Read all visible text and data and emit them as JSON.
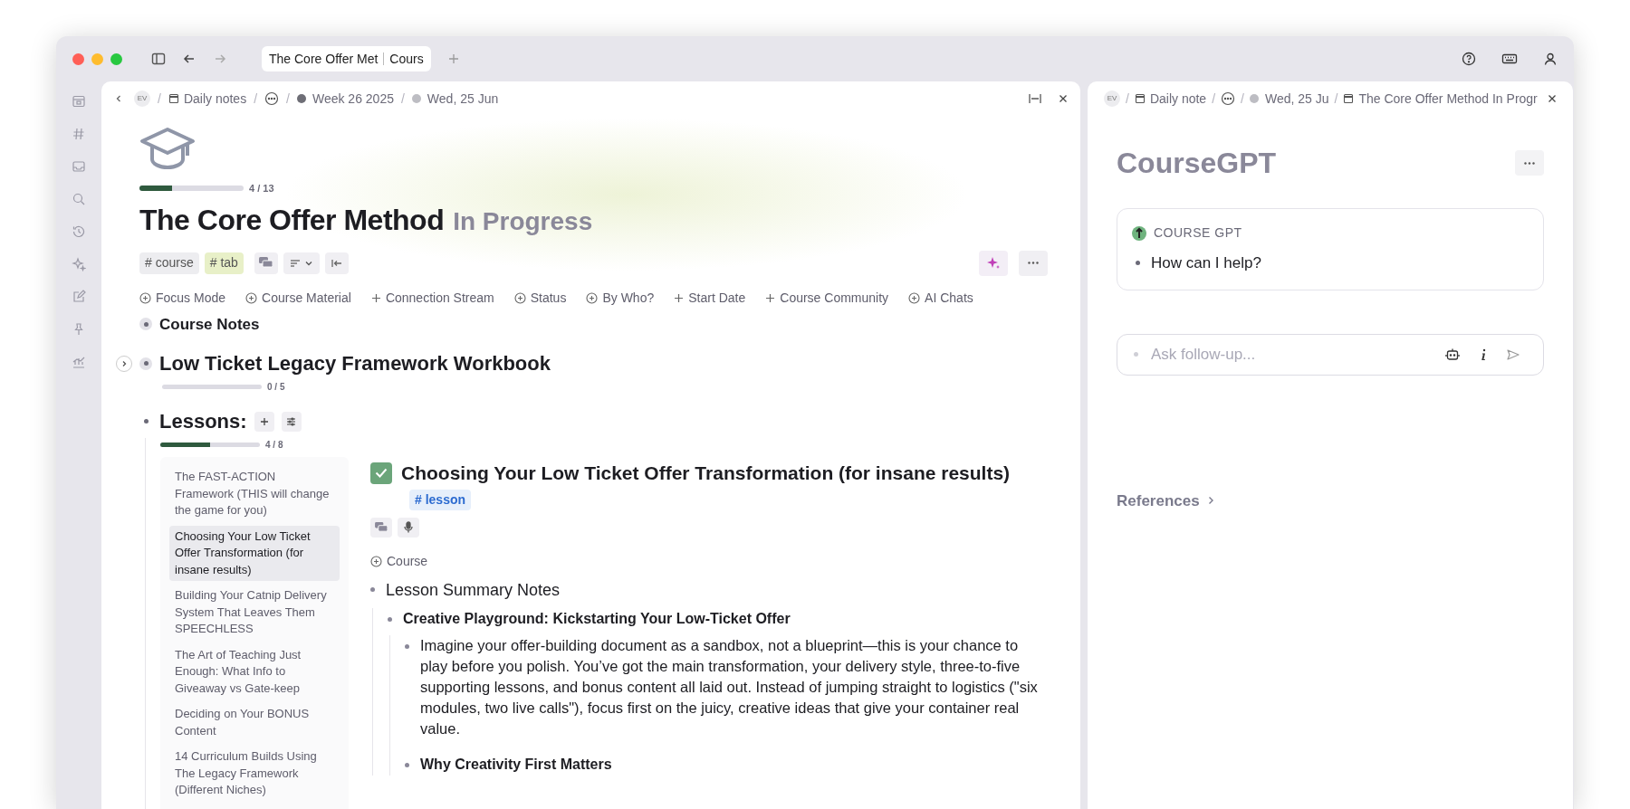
{
  "tab_bar": {
    "tab": {
      "parts": [
        "The Core Offer Met",
        "Cours"
      ],
      "selected": true
    }
  },
  "main": {
    "breadcrumb": [
      {
        "kind": "avatar",
        "text": "EV"
      },
      {
        "kind": "separator",
        "text": "/"
      },
      {
        "kind": "page",
        "text": "Daily notes"
      },
      {
        "kind": "separator",
        "text": "/"
      },
      {
        "kind": "more"
      },
      {
        "kind": "separator",
        "text": "/"
      },
      {
        "kind": "dot",
        "text": "Week 26 2025",
        "color": "#6e6e76"
      },
      {
        "kind": "separator",
        "text": "/"
      },
      {
        "kind": "dot",
        "text": "Wed, 25 Jun",
        "color": "#bdbdc3"
      }
    ],
    "progress": {
      "level": 0.31,
      "label": "4 / 13"
    },
    "title": "The Core Offer Method",
    "status": "In Progress",
    "tags": [
      {
        "text": "# course",
        "color": "#ededf0"
      },
      {
        "text": "# tab",
        "color": "#e8f0c8"
      }
    ],
    "properties": [
      {
        "kind": "circle",
        "label": "Focus Mode"
      },
      {
        "kind": "circle",
        "label": "Course Material"
      },
      {
        "kind": "plus",
        "label": "Connection Stream"
      },
      {
        "kind": "circle",
        "label": "Status"
      },
      {
        "kind": "circle",
        "label": "By Who?"
      },
      {
        "kind": "plus",
        "label": "Start Date"
      },
      {
        "kind": "plus",
        "label": "Course Community"
      },
      {
        "kind": "circle",
        "label": "AI Chats"
      }
    ],
    "course_notes": "Course Notes",
    "workbook": {
      "title": "Low Ticket Legacy Framework Workbook",
      "expanded": false,
      "progress": {
        "level": 0,
        "label": "0 / 5"
      }
    },
    "lessons": {
      "title": "Lessons:",
      "progress": {
        "level": 0.5,
        "label": "4 / 8"
      },
      "items": [
        {
          "label": "The FAST-ACTION Framework (THIS will change the game for you)",
          "selected": false
        },
        {
          "label": "Choosing Your Low Ticket Offer Transformation (for insane results)",
          "selected": true
        },
        {
          "label": "Building Your Catnip Delivery System That Leaves Them SPEECHLESS",
          "selected": false
        },
        {
          "label": "The Art of Teaching Just Enough: What Info to Giveaway vs Gate-keep",
          "selected": false
        },
        {
          "label": "Deciding on Your BONUS Content",
          "selected": false
        },
        {
          "label": "14 Curriculum Builds Using The Legacy Framework (Different Niches)",
          "selected": false
        }
      ]
    },
    "lesson": {
      "checked": true,
      "title": "Choosing Your Low Ticket Offer Transformation (for insane results)",
      "tag": "# lesson",
      "property": "Course",
      "notes": [
        {
          "text": "Lesson Summary Notes",
          "kind": "heading",
          "children": [
            {
              "text": "Creative Playground: Kickstarting Your Low-Ticket Offer",
              "kind": "bold",
              "children": [
                {
                  "text": "Imagine your offer-building document as a sandbox, not a blueprint—this is your chance to play before you polish. You’ve got the main transformation, your delivery style, three-to-five supporting lessons, and bonus content all laid out. Instead of jumping straight to logistics (\"six modules, two live calls\"), focus first on the juicy, creative ideas that give your container real value.",
                  "kind": "text"
                },
                {
                  "text": "Why Creativity First Matters",
                  "kind": "bold"
                }
              ]
            }
          ]
        }
      ]
    }
  },
  "side": {
    "breadcrumb": [
      {
        "kind": "avatar",
        "text": "EV"
      },
      {
        "kind": "separator",
        "text": "/"
      },
      {
        "kind": "page",
        "text": "Daily note"
      },
      {
        "kind": "separator",
        "text": "/"
      },
      {
        "kind": "more"
      },
      {
        "kind": "separator",
        "text": "/"
      },
      {
        "kind": "dot",
        "text": "Wed, 25 Ju",
        "color": "#bdbdc3"
      },
      {
        "kind": "separator",
        "text": "/"
      },
      {
        "kind": "page",
        "text": "The Core Offer Method In Progr"
      }
    ],
    "title": "CourseGPT",
    "message": {
      "sender": "COURSE GPT",
      "text": "How can I help?"
    },
    "input": {
      "placeholder": "Ask follow-up..."
    },
    "references": "References"
  }
}
